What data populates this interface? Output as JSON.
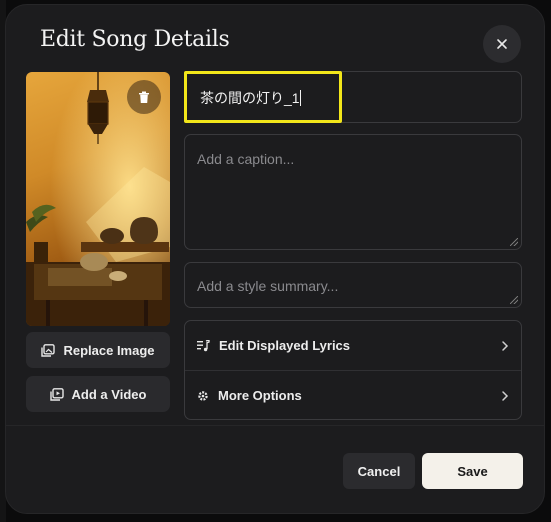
{
  "modal": {
    "title": "Edit Song Details",
    "close_label": "×"
  },
  "cover": {
    "replace_label": "Replace Image",
    "add_video_label": "Add a Video",
    "icons": [
      "trash-icon",
      "image-icon",
      "video-icon"
    ]
  },
  "form": {
    "title_value": "茶の間の灯り_1",
    "caption_placeholder": "Add a caption...",
    "style_placeholder": "Add a style summary..."
  },
  "options": {
    "lyrics_label": "Edit Displayed Lyrics",
    "more_label": "More Options"
  },
  "footer": {
    "cancel_label": "Cancel",
    "save_label": "Save"
  },
  "colors": {
    "highlight": "#f2e61a",
    "save_bg": "#f4f1ea",
    "modal_bg": "#1c1c1e"
  }
}
